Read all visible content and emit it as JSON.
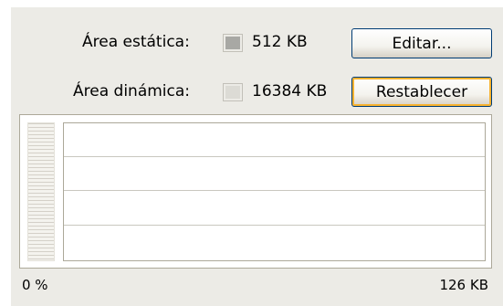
{
  "static_area": {
    "label": "Área estática:",
    "value": "512 KB",
    "color": "#a8a8a4"
  },
  "dynamic_area": {
    "label": "Área dinámica:",
    "value": "16384 KB",
    "color": "#dcdbd5"
  },
  "buttons": {
    "edit": "Editar...",
    "reset": "Restablecer"
  },
  "chart": {
    "left_label": "0 %",
    "right_label": "126 KB"
  }
}
